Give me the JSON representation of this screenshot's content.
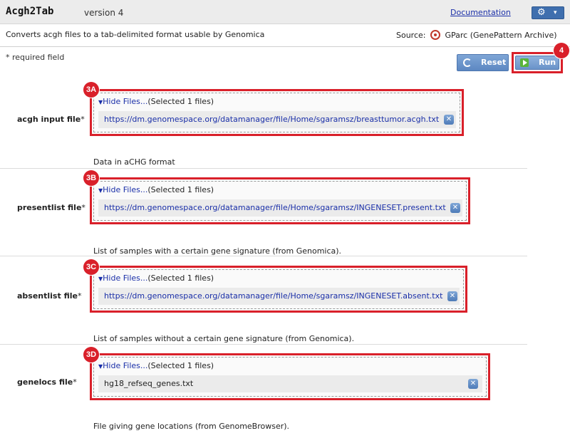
{
  "header": {
    "module_name": "Acgh2Tab",
    "version": "version 4",
    "documentation_link": "Documentation",
    "settings_icon": "gear-icon",
    "settings_caret": "▾"
  },
  "description": "Converts acgh files to a tab-delimited format usable by Genomica",
  "source": {
    "label": "Source:",
    "value": "GParc (GenePattern Archive)"
  },
  "required_note": "* required field",
  "buttons": {
    "reset_label": "Reset",
    "run_label": "Run"
  },
  "callouts": {
    "run": "4",
    "acgh": "3A",
    "presentlist": "3B",
    "absentlist": "3C",
    "genelocs": "3D"
  },
  "fields": [
    {
      "label": "acgh input file",
      "star": "*",
      "toggle_link": "Hide Files...",
      "toggle_text": "(Selected 1 files)",
      "file": "https://dm.genomespace.org/datamanager/file/Home/sgaramsz/breasttumor.acgh.txt",
      "help": "Data in aCHG format"
    },
    {
      "label": "presentlist file",
      "star": "*",
      "toggle_link": "Hide Files...",
      "toggle_text": "(Selected 1 files)",
      "file": "https://dm.genomespace.org/datamanager/file/Home/sgaramsz/INGENESET.present.txt",
      "help": "List of samples with a certain gene signature (from Genomica)."
    },
    {
      "label": "absentlist file",
      "star": "*",
      "toggle_link": "Hide Files...",
      "toggle_text": "(Selected 1 files)",
      "file": "https://dm.genomespace.org/datamanager/file/Home/sgaramsz/INGENESET.absent.txt",
      "help": "List of samples without a certain gene signature (from Genomica)."
    },
    {
      "label": "genelocs file",
      "star": "*",
      "toggle_link": "Hide Files...",
      "toggle_text": "(Selected 1 files)",
      "file": "hg18_refseq_genes.txt",
      "help": "File giving gene locations (from GenomeBrowser)."
    }
  ],
  "colors": {
    "callout_red": "#d9202a",
    "button_blue": "#5c87c2",
    "link_blue": "#1a2fa8"
  }
}
